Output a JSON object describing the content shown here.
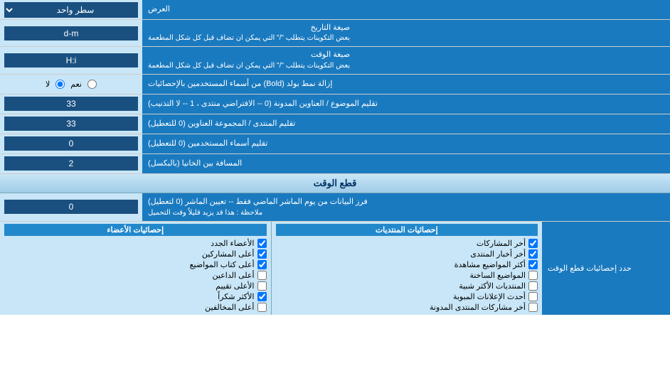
{
  "rows": [
    {
      "id": "row-ard",
      "label": "العرض",
      "control_type": "select",
      "control_value": "سطر واحد"
    },
    {
      "id": "row-date-format",
      "label": "صيغة التاريخ",
      "sublabel": "بعض التكوينات يتطلب \"/\" التي يمكن ان تضاف قبل كل شكل المطعمة",
      "control_type": "text",
      "control_value": "d-m"
    },
    {
      "id": "row-time-format",
      "label": "صيغة الوقت",
      "sublabel": "بعض التكوينات يتطلب \"/\" التي يمكن ان تضاف قبل كل شكل المطعمة",
      "control_type": "text",
      "control_value": "H:i"
    },
    {
      "id": "row-bold",
      "label": "إزالة نمط بولد (Bold) من أسماء المستخدمين بالإحصائيات",
      "control_type": "radio",
      "radio_options": [
        "نعم",
        "لا"
      ],
      "radio_selected": "لا"
    },
    {
      "id": "row-topic-count",
      "label": "تقليم الموضوع / العناوين المدونة (0 -- الافتراضي منتدى ، 1 -- لا التذنيب)",
      "control_type": "text",
      "control_value": "33"
    },
    {
      "id": "row-forum-count",
      "label": "تقليم المنتدى / المجموعة العناوين (0 للتعطيل)",
      "control_type": "text",
      "control_value": "33"
    },
    {
      "id": "row-user-count",
      "label": "تقليم أسماء المستخدمين (0 للتعطيل)",
      "control_type": "text",
      "control_value": "0"
    },
    {
      "id": "row-space",
      "label": "المسافة بين الخانيا (بالبكسل)",
      "control_type": "text",
      "control_value": "2"
    }
  ],
  "section_cutoff": {
    "title": "قطع الوقت",
    "row": {
      "label": "فرز البيانات من يوم الماشر الماضي فقط -- تعيين الماشر (0 لتعطيل)\nملاحظة : هذا قد يزيد قليلاً وقت التحميل",
      "control_value": "0"
    },
    "stats_label": "حدد إحصائيات قطع الوقت"
  },
  "stats_columns": {
    "left_label": "حدد إحصائيات قطع الوقت",
    "col1": {
      "title": "إحصائيات المنتديات",
      "items": [
        "أخر المشاركات",
        "أخر أخبار المنتدى",
        "أكثر المواضيع مشاهدة",
        "المواضيع الساخنة",
        "المنتديات الأكثر شبية",
        "أحدث الإعلانات المبوبة",
        "أخر مشاركات المنتدى المدونة"
      ]
    },
    "col2": {
      "title": "إحصائيات الأعضاء",
      "items": [
        "الأعضاء الجدد",
        "أعلى المشاركين",
        "أعلى كتاب المواضيع",
        "أعلى الداعين",
        "الأعلى تقييم",
        "الأكثر شكراً",
        "أعلى المخالفين"
      ]
    }
  }
}
